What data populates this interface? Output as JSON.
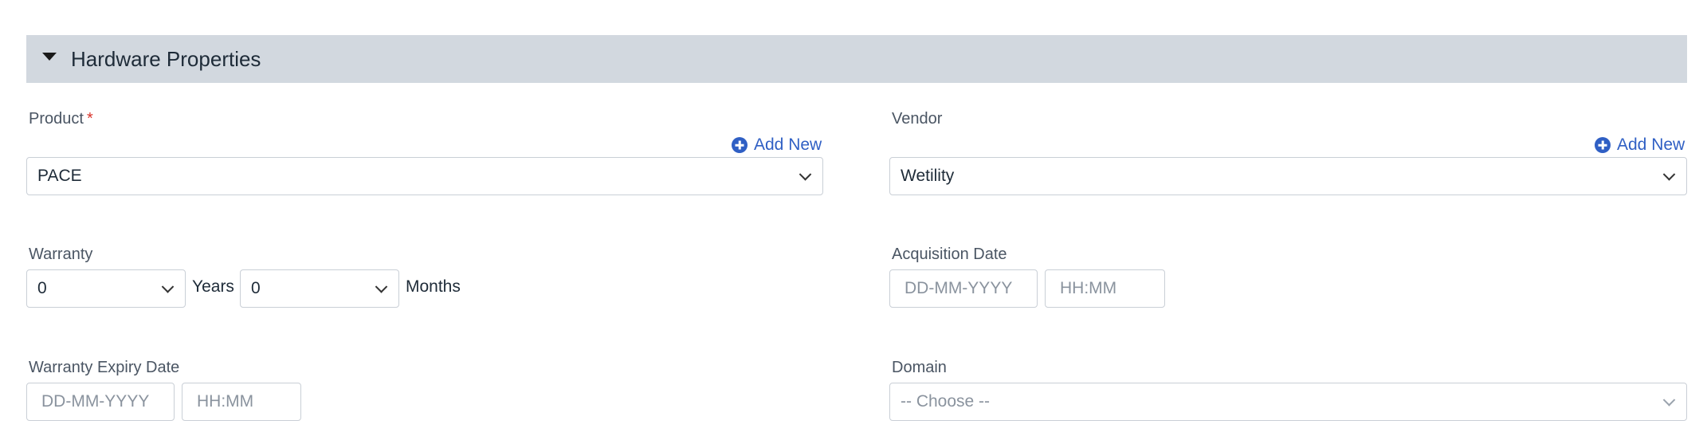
{
  "section": {
    "title": "Hardware Properties"
  },
  "product": {
    "label": "Product",
    "required_mark": "*",
    "add_new": "Add New",
    "value": "PACE"
  },
  "vendor": {
    "label": "Vendor",
    "add_new": "Add New",
    "value": "Wetility"
  },
  "warranty": {
    "label": "Warranty",
    "years_value": "0",
    "years_unit": "Years",
    "months_value": "0",
    "months_unit": "Months"
  },
  "acquisition_date": {
    "label": "Acquisition Date",
    "date_placeholder": "DD-MM-YYYY",
    "time_placeholder": "HH:MM"
  },
  "warranty_expiry_date": {
    "label": "Warranty Expiry Date",
    "date_placeholder": "DD-MM-YYYY",
    "time_placeholder": "HH:MM"
  },
  "domain": {
    "label": "Domain",
    "placeholder": "-- Choose --"
  },
  "colors": {
    "section_bg": "#d2d8df",
    "link": "#2f5fc4",
    "required": "#d9342b"
  }
}
